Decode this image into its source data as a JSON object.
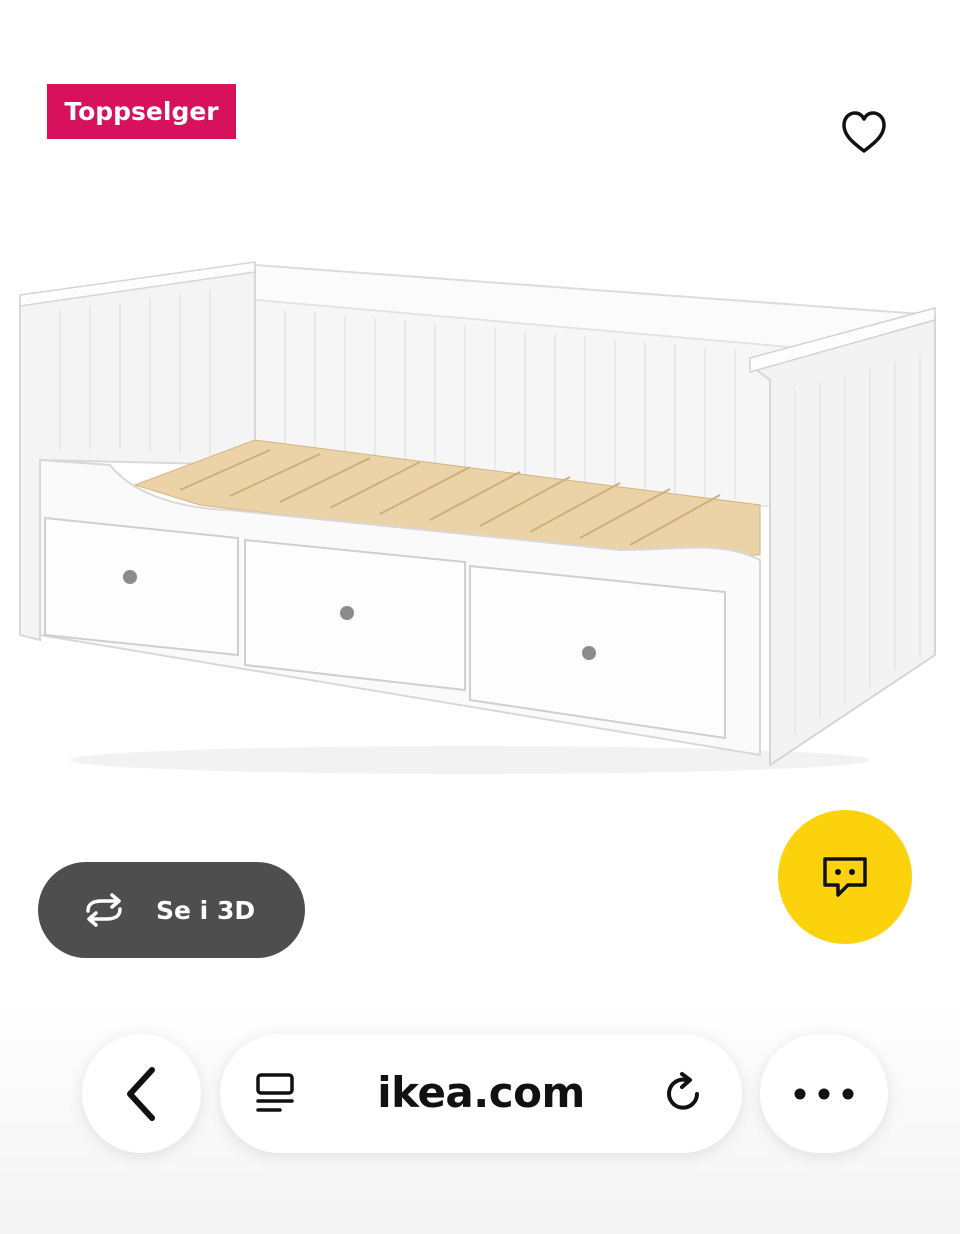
{
  "badge": {
    "label": "Toppselger",
    "color": "#d8115c"
  },
  "favorite": {
    "icon": "heart-icon"
  },
  "product": {
    "image": "white-daybed-with-three-drawers"
  },
  "view_3d": {
    "label": "Se i 3D",
    "icon": "rotate-3d-icon"
  },
  "chat": {
    "icon": "chat-bubble-icon",
    "color": "#fcd20c"
  },
  "browser_toolbar": {
    "back_icon": "chevron-left-icon",
    "reader_icon": "reader-mode-icon",
    "url": "ikea.com",
    "reload_icon": "reload-icon",
    "more_icon": "more-dots-icon"
  }
}
